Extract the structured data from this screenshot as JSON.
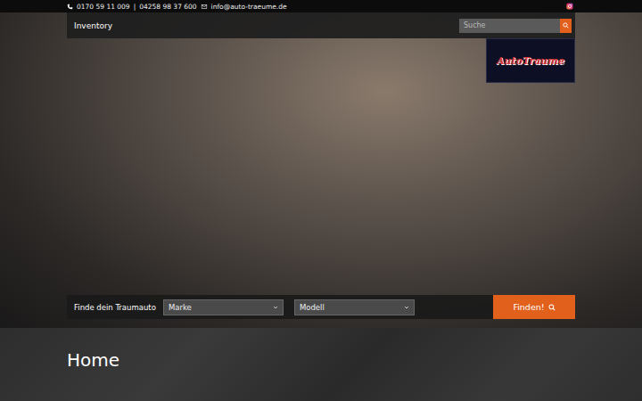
{
  "topbar": {
    "phone": "0170 59 11 009",
    "separator": "|",
    "phone2": "04258 98 37 600",
    "email": "info@auto-traeume.de"
  },
  "nav": {
    "items": [
      {
        "label": "Inventory"
      }
    ]
  },
  "search": {
    "placeholder": "Suche"
  },
  "logo": {
    "text": "AutoTraume"
  },
  "finder": {
    "label": "Finde dein Traumauto",
    "selects": [
      "Marke",
      "Modell"
    ],
    "button": "Finden!"
  },
  "page": {
    "title": "Home"
  }
}
